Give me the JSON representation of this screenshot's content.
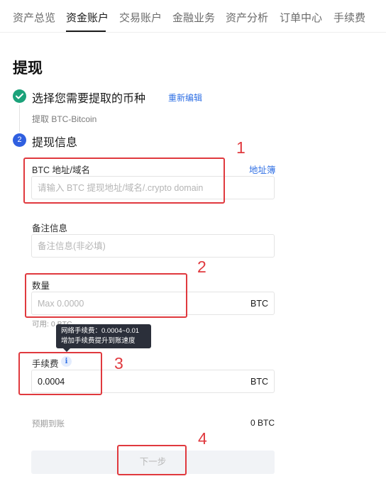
{
  "tabs": [
    {
      "label": "资产总览"
    },
    {
      "label": "资金账户"
    },
    {
      "label": "交易账户"
    },
    {
      "label": "金融业务"
    },
    {
      "label": "资产分析"
    },
    {
      "label": "订单中心"
    },
    {
      "label": "手续费"
    }
  ],
  "active_tab": "资金账户",
  "page_title": "提现",
  "step1": {
    "label": "选择您需要提取的币种",
    "edit_link": "重新编辑",
    "subtitle": "提取 BTC-Bitcoin"
  },
  "step2": {
    "number": "2",
    "label": "提现信息"
  },
  "address_field": {
    "label": "BTC 地址/域名",
    "link": "地址簿",
    "placeholder": "请输入 BTC 提现地址/域名/.crypto domain",
    "value": ""
  },
  "memo_field": {
    "label": "备注信息",
    "placeholder": "备注信息(非必填)",
    "value": ""
  },
  "amount_field": {
    "label": "数量",
    "placeholder": "Max 0.0000",
    "value": "",
    "unit": "BTC",
    "available": "可用: 0 BTC"
  },
  "fee_field": {
    "label": "手续费",
    "info_glyph": "i",
    "value": "0.0004",
    "unit": "BTC",
    "tooltip_line1": "网络手续费：0.0004~0.01",
    "tooltip_line2": "增加手续费提升到账速度"
  },
  "expected": {
    "label": "预期到账",
    "value": "0 BTC"
  },
  "next_button": "下一步",
  "annotations": [
    "1",
    "2",
    "3",
    "4"
  ],
  "colors": {
    "accent_blue": "#2f6fe4",
    "success_green": "#1ba27a",
    "annotation_red": "#e0393e",
    "tooltip_bg": "#2b2f3a"
  }
}
